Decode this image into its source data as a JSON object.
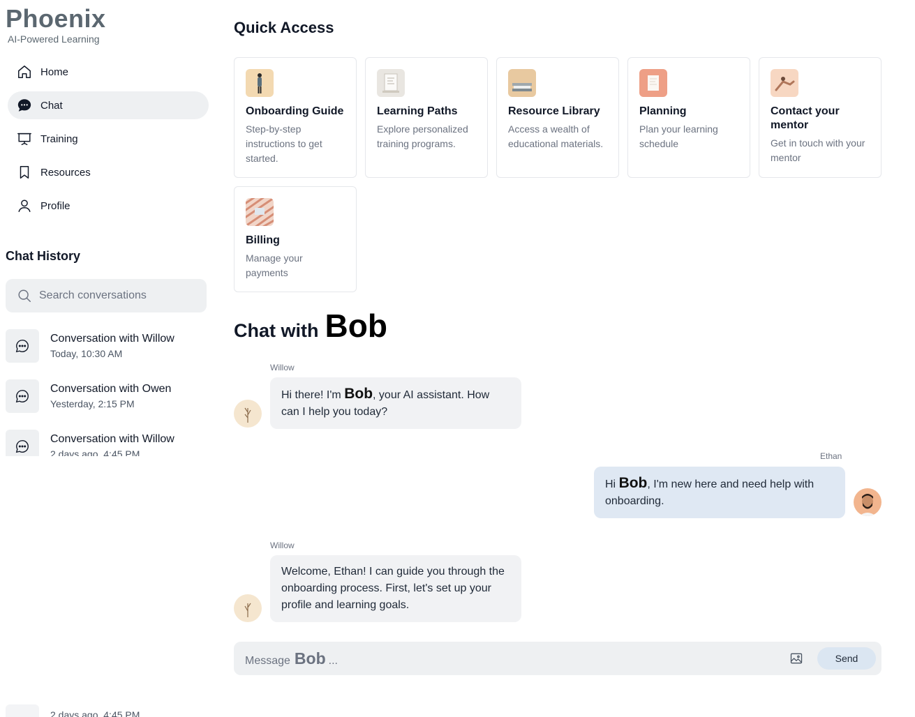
{
  "brand": {
    "title": "Phoenix",
    "subtitle": "AI-Powered Learning"
  },
  "nav": [
    {
      "label": "Home",
      "icon": "home-icon",
      "active": false
    },
    {
      "label": "Chat",
      "icon": "chat-bubble-icon",
      "active": true
    },
    {
      "label": "Training",
      "icon": "presentation-icon",
      "active": false
    },
    {
      "label": "Resources",
      "icon": "bookmark-icon",
      "active": false
    },
    {
      "label": "Profile",
      "icon": "user-icon",
      "active": false
    }
  ],
  "history": {
    "title": "Chat History",
    "search_placeholder": "Search conversations",
    "items": [
      {
        "title": "Conversation with Willow",
        "time": "Today, 10:30 AM"
      },
      {
        "title": "Conversation with Owen",
        "time": "Yesterday, 2:15 PM"
      },
      {
        "title": "Conversation with Willow",
        "time": "2 days ago, 4:45 PM"
      }
    ],
    "overflow_time": "2 days ago, 4:45 PM"
  },
  "quick_access": {
    "title": "Quick Access",
    "cards": [
      {
        "title": "Onboarding Guide",
        "desc": "Step-by-step instructions to get started.",
        "icon": "onboarding-image"
      },
      {
        "title": "Learning Paths",
        "desc": "Explore personalized training programs.",
        "icon": "learning-paths-image"
      },
      {
        "title": "Resource Library",
        "desc": "Access a wealth of educational materials.",
        "icon": "library-image"
      },
      {
        "title": "Planning",
        "desc": "Plan your learning schedule",
        "icon": "planning-image"
      },
      {
        "title": "Contact your mentor",
        "desc": "Get in touch with your mentor",
        "icon": "mentor-image"
      },
      {
        "title": "Billing",
        "desc": "Manage your payments",
        "icon": "billing-image"
      }
    ]
  },
  "chat": {
    "title_prefix": "Chat with",
    "assistant_name": "Bob",
    "messages": [
      {
        "sender": "Willow",
        "role": "assistant",
        "pre": "Hi there! I'm",
        "bob": "Bob",
        "post": ", your AI assistant. How can I help you today?"
      },
      {
        "sender": "Ethan",
        "role": "user",
        "pre": "Hi",
        "bob": "Bob",
        "post": ", I'm new here and need help with onboarding."
      },
      {
        "sender": "Willow",
        "role": "assistant",
        "text": "Welcome, Ethan! I can guide you through the onboarding process. First, let's set up your profile and learning goals."
      }
    ],
    "composer": {
      "placeholder_prefix": "Message",
      "placeholder_name": "Bob",
      "placeholder_suffix": "...",
      "send_label": "Send"
    }
  },
  "colors": {
    "brand": "#5b6770",
    "active_nav": "#eef0f2",
    "user_bubble": "#dfe8f3",
    "assistant_bubble": "#f1f2f4",
    "send_button": "#dbe6f2"
  }
}
